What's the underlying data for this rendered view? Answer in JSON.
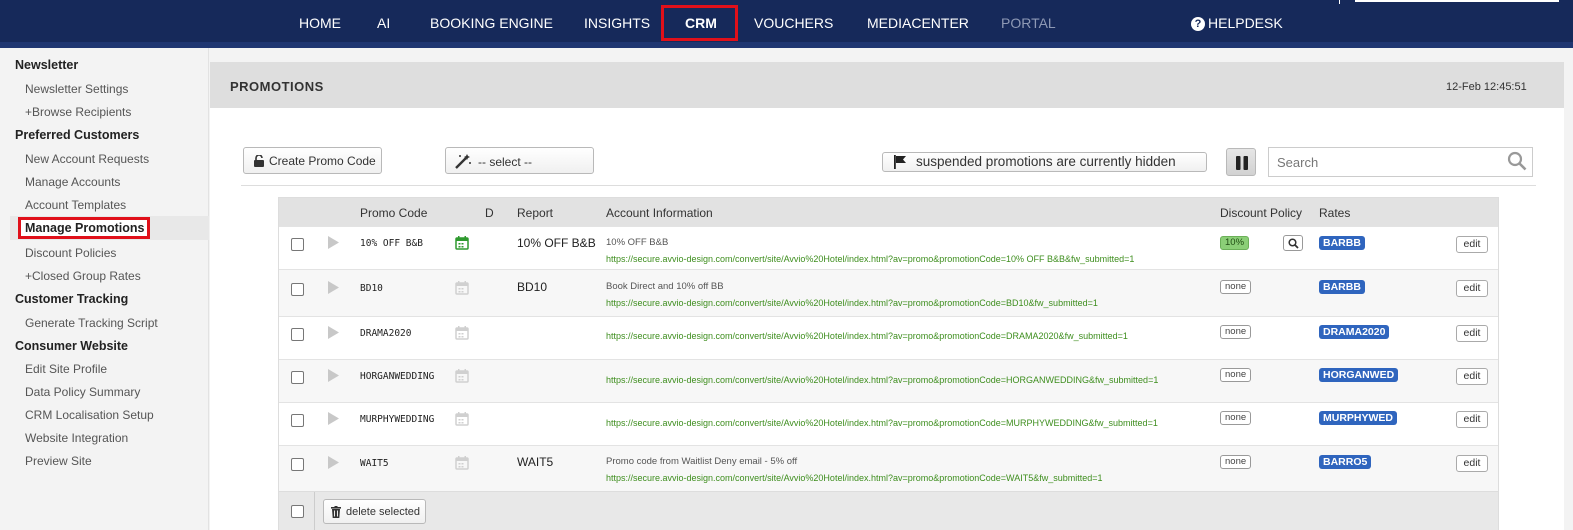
{
  "nav": {
    "items": [
      {
        "label": "HOME"
      },
      {
        "label": "AI"
      },
      {
        "label": "BOOKING ENGINE"
      },
      {
        "label": "INSIGHTS"
      },
      {
        "label": "CRM"
      },
      {
        "label": "VOUCHERS"
      },
      {
        "label": "MEDIACENTER"
      },
      {
        "label": "PORTAL"
      },
      {
        "label": "HELPDESK"
      }
    ]
  },
  "sidebar": {
    "newsletter": "Newsletter",
    "newsletter_settings": "Newsletter Settings",
    "browse_recipients": "+Browse Recipients",
    "preferred_customers": "Preferred Customers",
    "new_account_requests": "New Account Requests",
    "manage_accounts": "Manage Accounts",
    "account_templates": "Account Templates",
    "manage_promotions": "Manage Promotions",
    "discount_policies": "Discount Policies",
    "closed_group_rates": "+Closed Group Rates",
    "customer_tracking": "Customer Tracking",
    "generate_tracking_script": "Generate Tracking Script",
    "consumer_website": "Consumer Website",
    "edit_site_profile": "Edit Site Profile",
    "data_policy_summary": "Data Policy Summary",
    "crm_localisation_setup": "CRM Localisation Setup",
    "website_integration": "Website Integration",
    "preview_site": "Preview Site"
  },
  "page": {
    "title": "PROMOTIONS",
    "time": "12-Feb 12:45:51"
  },
  "toolbar": {
    "create_label": "Create Promo Code",
    "select_label": "-- select --",
    "suspended_label": "suspended promotions are currently hidden",
    "search_placeholder": "Search"
  },
  "table": {
    "headers": {
      "promo_code": "Promo Code",
      "d": "D",
      "report": "Report",
      "account_information": "Account Information",
      "discount_policy": "Discount Policy",
      "rates": "Rates"
    },
    "rows": [
      {
        "code": "10% OFF B&B",
        "report": "10% OFF B&B",
        "account": "10% OFF B&B",
        "url": "https://secure.avvio-design.com/convert/site/Avvio%20Hotel/index.html?av=promo&promotionCode=10% OFF B&B&fw_submitted=1",
        "policy": "10%",
        "rate": "BARBB",
        "edit": "edit"
      },
      {
        "code": "BD10",
        "report": "BD10",
        "account": "Book Direct and 10% off BB",
        "url": "https://secure.avvio-design.com/convert/site/Avvio%20Hotel/index.html?av=promo&promotionCode=BD10&fw_submitted=1",
        "policy": "none",
        "rate": "BARBB",
        "edit": "edit"
      },
      {
        "code": "DRAMA2020",
        "report": "",
        "account": "",
        "url": "https://secure.avvio-design.com/convert/site/Avvio%20Hotel/index.html?av=promo&promotionCode=DRAMA2020&fw_submitted=1",
        "policy": "none",
        "rate": "DRAMA2020",
        "edit": "edit"
      },
      {
        "code": "HORGANWEDDING",
        "report": "",
        "account": "",
        "url": "https://secure.avvio-design.com/convert/site/Avvio%20Hotel/index.html?av=promo&promotionCode=HORGANWEDDING&fw_submitted=1",
        "policy": "none",
        "rate": "HORGANWED",
        "edit": "edit"
      },
      {
        "code": "MURPHYWEDDING",
        "report": "",
        "account": "",
        "url": "https://secure.avvio-design.com/convert/site/Avvio%20Hotel/index.html?av=promo&promotionCode=MURPHYWEDDING&fw_submitted=1",
        "policy": "none",
        "rate": "MURPHYWED",
        "edit": "edit"
      },
      {
        "code": "WAIT5",
        "report": "WAIT5",
        "account": "Promo code from Waitlist Deny email - 5% off",
        "url": "https://secure.avvio-design.com/convert/site/Avvio%20Hotel/index.html?av=promo&promotionCode=WAIT5&fw_submitted=1",
        "policy": "none",
        "rate": "BARRO5",
        "edit": "edit"
      }
    ],
    "delete_label": "delete selected"
  },
  "colors": {
    "nav_bg": "#16295a",
    "highlight": "#e0101a",
    "rate_badge": "#2f65be",
    "url_green": "#3e8e1e",
    "policy_green": "#8bcf77"
  }
}
